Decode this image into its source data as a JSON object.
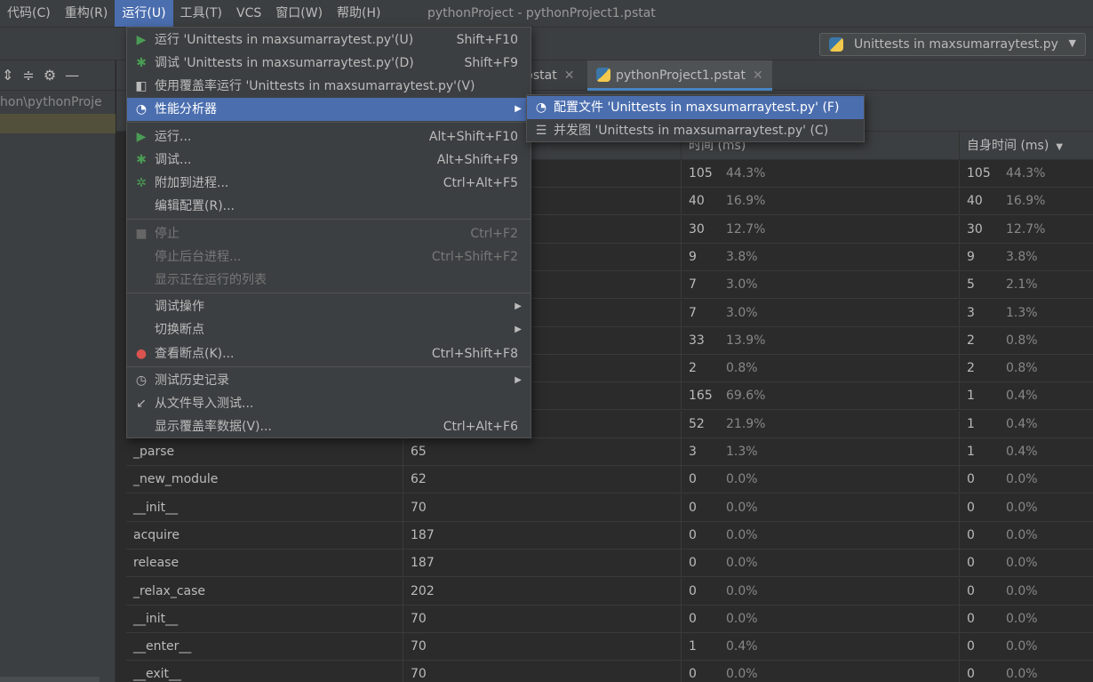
{
  "menubar": {
    "items": [
      {
        "label": "代码(C)"
      },
      {
        "label": "重构(R)"
      },
      {
        "label": "运行(U)"
      },
      {
        "label": "工具(T)"
      },
      {
        "label": "VCS"
      },
      {
        "label": "窗口(W)"
      },
      {
        "label": "帮助(H)"
      }
    ],
    "window_title": "pythonProject - pythonProject1.pstat"
  },
  "toolbar": {
    "run_config": "Unittests in maxsumarraytest.py"
  },
  "project_panel": {
    "path": "hon\\pythonProje"
  },
  "tabs": [
    {
      "label": "pstat"
    },
    {
      "label": "pythonProject1.pstat"
    }
  ],
  "run_menu": {
    "items": [
      {
        "label": "运行 'Unittests in maxsumarraytest.py'(U)",
        "shortcut": "Shift+F10",
        "icon": "run-icon"
      },
      {
        "label": "调试 'Unittests in maxsumarraytest.py'(D)",
        "shortcut": "Shift+F9",
        "icon": "debug-icon"
      },
      {
        "label": "使用覆盖率运行  'Unittests in maxsumarraytest.py'(V)",
        "shortcut": "",
        "icon": "coverage-icon"
      },
      {
        "label": "性能分析器",
        "shortcut": "",
        "icon": "profiler-icon"
      },
      {
        "label": "运行...",
        "shortcut": "Alt+Shift+F10",
        "icon": "run-icon"
      },
      {
        "label": "调试...",
        "shortcut": "Alt+Shift+F9",
        "icon": "debug-icon"
      },
      {
        "label": "附加到进程...",
        "shortcut": "Ctrl+Alt+F5",
        "icon": "attach-icon"
      },
      {
        "label": "编辑配置(R)...",
        "shortcut": "",
        "icon": ""
      },
      {
        "label": "停止",
        "shortcut": "Ctrl+F2",
        "icon": "stop-icon"
      },
      {
        "label": "停止后台进程...",
        "shortcut": "Ctrl+Shift+F2",
        "icon": ""
      },
      {
        "label": "显示正在运行的列表",
        "shortcut": "",
        "icon": ""
      },
      {
        "label": "调试操作",
        "shortcut": "",
        "icon": ""
      },
      {
        "label": "切换断点",
        "shortcut": "",
        "icon": ""
      },
      {
        "label": "查看断点(K)...",
        "shortcut": "Ctrl+Shift+F8",
        "icon": "breakpoints-icon"
      },
      {
        "label": "测试历史记录",
        "shortcut": "",
        "icon": "history-icon"
      },
      {
        "label": "从文件导入测试...",
        "shortcut": "",
        "icon": "import-icon"
      },
      {
        "label": "显示覆盖率数据(V)...",
        "shortcut": "Ctrl+Alt+F6",
        "icon": ""
      }
    ]
  },
  "profiler_submenu": {
    "items": [
      {
        "label": "配置文件 'Unittests in maxsumarraytest.py' (F)"
      },
      {
        "label": "并发图 'Unittests in maxsumarraytest.py' (C)"
      }
    ]
  },
  "stats_table": {
    "columns": [
      "",
      "",
      "时间 (ms)",
      "自身时间 (ms)"
    ],
    "rows": [
      {
        "name": "",
        "calls": "",
        "time": "105",
        "time_pct": "44.3%",
        "own": "105",
        "own_pct": "44.3%"
      },
      {
        "name": "",
        "calls": "",
        "time": "40",
        "time_pct": "16.9%",
        "own": "40",
        "own_pct": "16.9%"
      },
      {
        "name": "",
        "calls": "",
        "time": "30",
        "time_pct": "12.7%",
        "own": "30",
        "own_pct": "12.7%"
      },
      {
        "name": "",
        "calls": "",
        "time": "9",
        "time_pct": "3.8%",
        "own": "9",
        "own_pct": "3.8%"
      },
      {
        "name": "",
        "calls": "",
        "time": "7",
        "time_pct": "3.0%",
        "own": "5",
        "own_pct": "2.1%"
      },
      {
        "name": "",
        "calls": "",
        "time": "7",
        "time_pct": "3.0%",
        "own": "3",
        "own_pct": "1.3%"
      },
      {
        "name": "",
        "calls": "",
        "time": "33",
        "time_pct": "13.9%",
        "own": "2",
        "own_pct": "0.8%"
      },
      {
        "name": "",
        "calls": "",
        "time": "2",
        "time_pct": "0.8%",
        "own": "2",
        "own_pct": "0.8%"
      },
      {
        "name": "",
        "calls": "",
        "time": "165",
        "time_pct": "69.6%",
        "own": "1",
        "own_pct": "0.4%"
      },
      {
        "name": "",
        "calls": "",
        "time": "52",
        "time_pct": "21.9%",
        "own": "1",
        "own_pct": "0.4%"
      },
      {
        "name": "_parse",
        "calls": "65",
        "time": "3",
        "time_pct": "1.3%",
        "own": "1",
        "own_pct": "0.4%"
      },
      {
        "name": "_new_module",
        "calls": "62",
        "time": "0",
        "time_pct": "0.0%",
        "own": "0",
        "own_pct": "0.0%"
      },
      {
        "name": "__init__",
        "calls": "70",
        "time": "0",
        "time_pct": "0.0%",
        "own": "0",
        "own_pct": "0.0%"
      },
      {
        "name": "acquire",
        "calls": "187",
        "time": "0",
        "time_pct": "0.0%",
        "own": "0",
        "own_pct": "0.0%"
      },
      {
        "name": "release",
        "calls": "187",
        "time": "0",
        "time_pct": "0.0%",
        "own": "0",
        "own_pct": "0.0%"
      },
      {
        "name": "_relax_case",
        "calls": "202",
        "time": "0",
        "time_pct": "0.0%",
        "own": "0",
        "own_pct": "0.0%"
      },
      {
        "name": "__init__",
        "calls": "70",
        "time": "0",
        "time_pct": "0.0%",
        "own": "0",
        "own_pct": "0.0%"
      },
      {
        "name": "__enter__",
        "calls": "70",
        "time": "1",
        "time_pct": "0.4%",
        "own": "0",
        "own_pct": "0.0%"
      },
      {
        "name": "__exit__",
        "calls": "70",
        "time": "0",
        "time_pct": "0.0%",
        "own": "0",
        "own_pct": "0.0%"
      }
    ]
  },
  "colors": {
    "accent": "#4b6eaf",
    "background": "#2b2b2b",
    "panel": "#3c3f41"
  }
}
